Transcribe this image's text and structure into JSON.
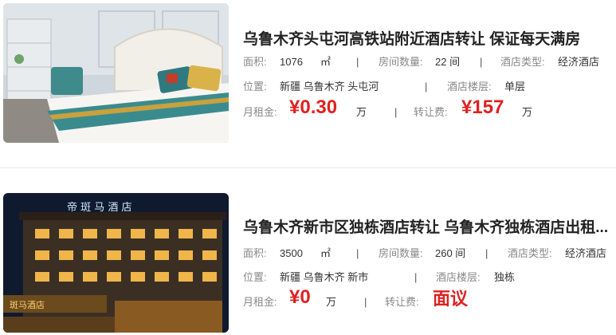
{
  "listings": [
    {
      "title": "乌鲁木齐头屯河高铁站附近酒店转让 保证每天满房",
      "area_label": "面积:",
      "area_value": "1076",
      "area_unit": "㎡",
      "rooms_label": "房间数量:",
      "rooms_value": "22 间",
      "type_label": "酒店类型:",
      "type_value": "经济酒店",
      "location_label": "位置:",
      "location_value": "新疆 乌鲁木齐 头屯河",
      "floor_label": "酒店楼层:",
      "floor_value": "单层",
      "rent_label": "月租金:",
      "rent_value": "¥0.30",
      "rent_unit": "万",
      "fee_label": "转让费:",
      "fee_value": "¥157",
      "fee_unit": "万",
      "separator": "|"
    },
    {
      "title": "乌鲁木齐新市区独栋酒店转让 乌鲁木齐独栋酒店出租...",
      "area_label": "面积:",
      "area_value": "3500",
      "area_unit": "㎡",
      "rooms_label": "房间数量:",
      "rooms_value": "260 间",
      "type_label": "酒店类型:",
      "type_value": "经济酒店",
      "location_label": "位置:",
      "location_value": "新疆 乌鲁木齐 新市",
      "floor_label": "酒店楼层:",
      "floor_value": "独栋",
      "rent_label": "月租金:",
      "rent_value": "¥0",
      "rent_unit": "万",
      "fee_label": "转让费:",
      "fee_value": "面议",
      "separator": "|"
    }
  ],
  "colors": {
    "price_red": "#e02020",
    "label_gray": "#888888",
    "title_dark": "#222222"
  }
}
